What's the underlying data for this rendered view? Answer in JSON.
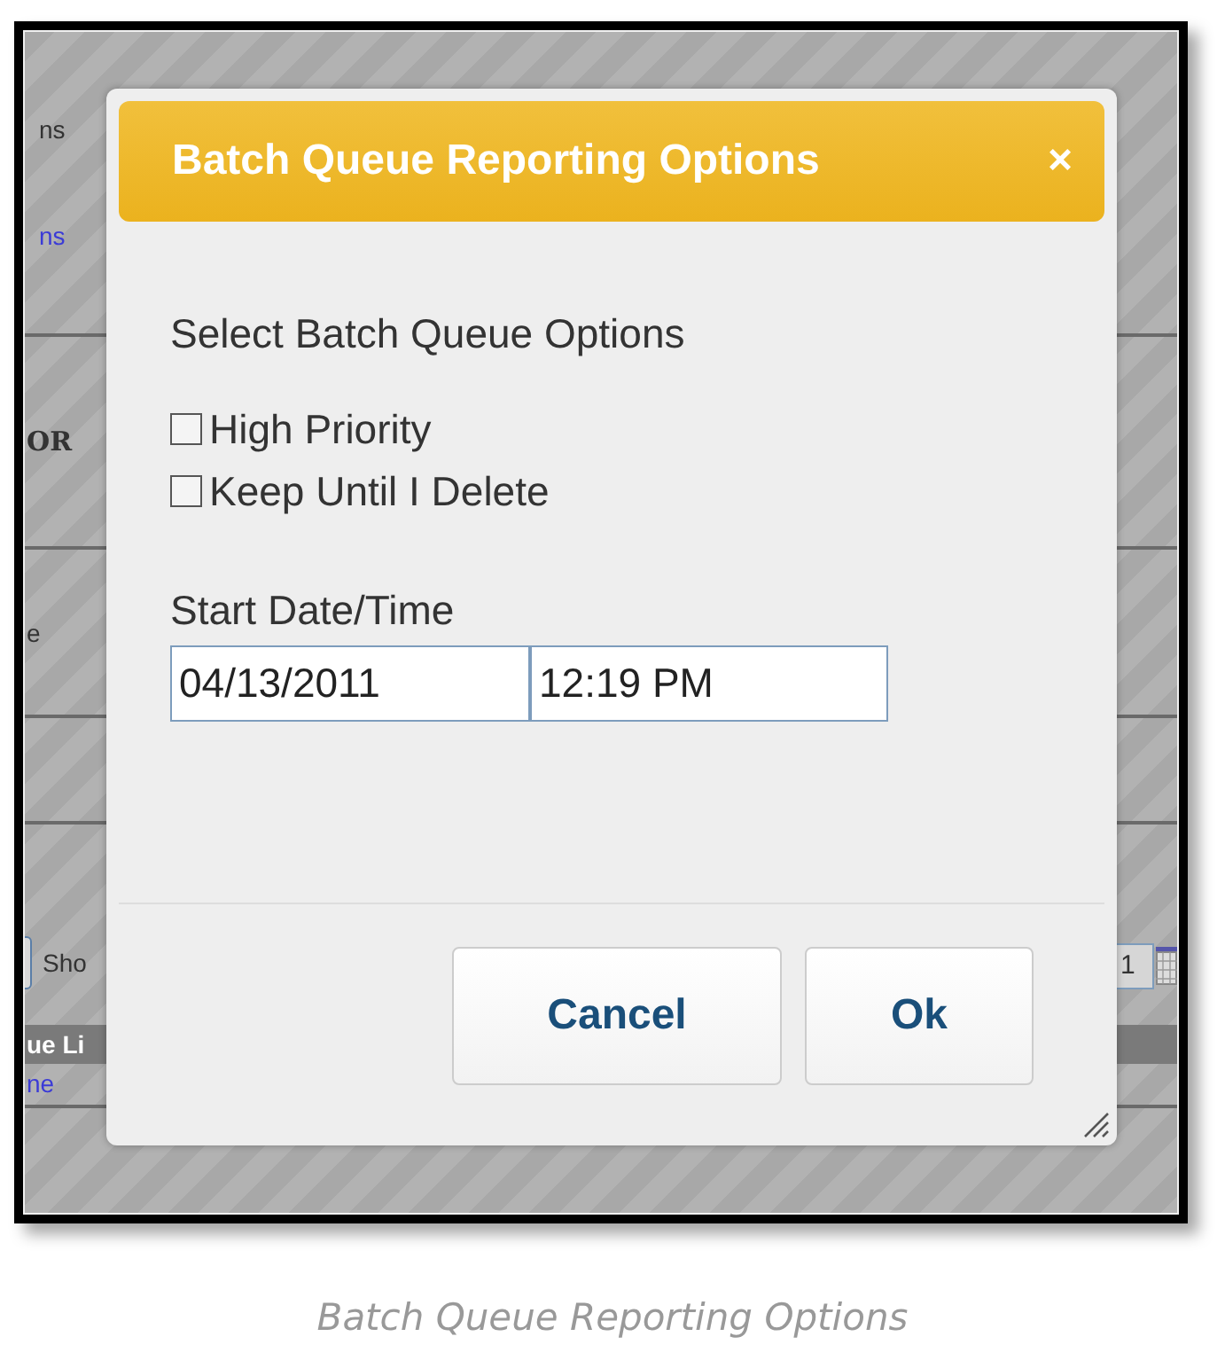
{
  "background_page": {
    "left_texts": [
      {
        "kind": "text",
        "text": "ns"
      },
      {
        "kind": "link",
        "text": "ns"
      },
      {
        "kind": "bold",
        "text": "OR"
      },
      {
        "kind": "text",
        "text": "e"
      }
    ],
    "show_label": "Sho",
    "page_field": {
      "value": "1"
    },
    "list_header": "ue Li",
    "list_link": "ne"
  },
  "dialog": {
    "title": "Batch Queue Reporting Options",
    "close": "×",
    "section_label": "Select Batch Queue Options",
    "checkboxes": [
      {
        "label": "High Priority",
        "checked": false
      },
      {
        "label": "Keep Until I Delete",
        "checked": false
      }
    ],
    "start_label": "Start Date/Time",
    "date_field": {
      "value": "04/13/2011"
    },
    "time_field": {
      "value": "12:19 PM"
    },
    "buttons": [
      {
        "label": "Cancel"
      },
      {
        "label": "Ok"
      }
    ]
  },
  "caption": "Batch Queue Reporting Options"
}
